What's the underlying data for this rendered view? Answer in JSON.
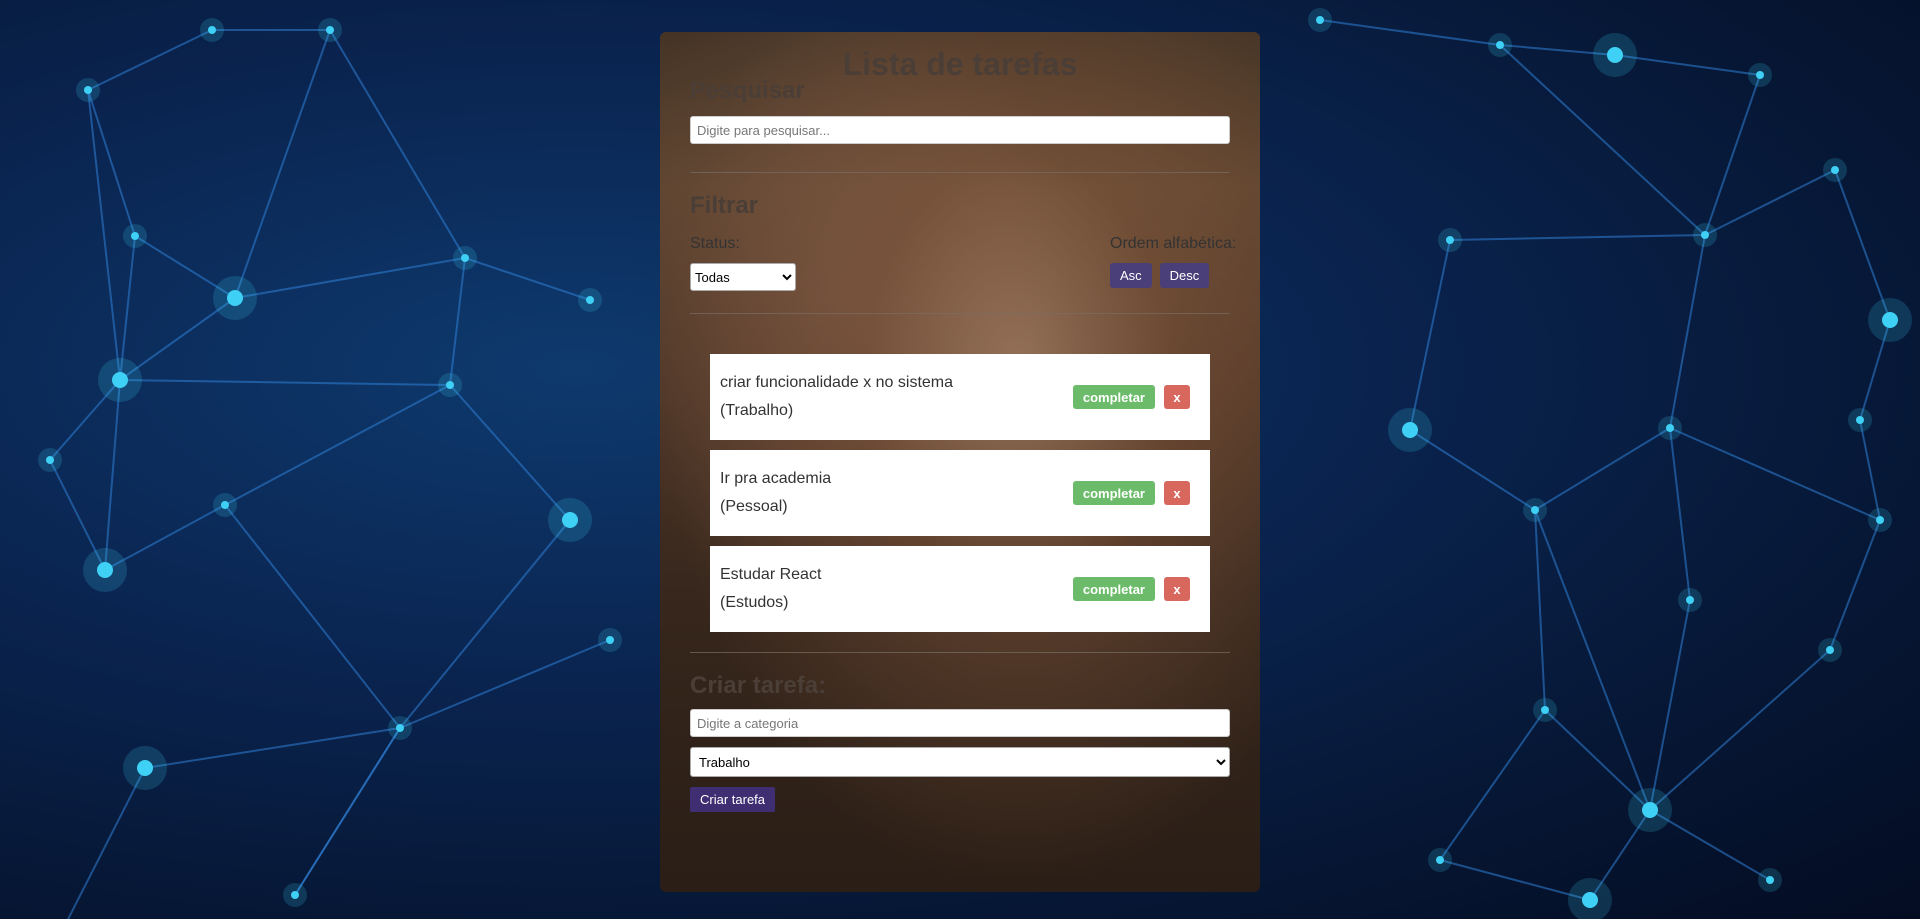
{
  "app": {
    "title": "Lista de tarefas"
  },
  "search": {
    "title": "Pesquisar",
    "placeholder": "Digite para pesquisar..."
  },
  "filter": {
    "title": "Filtrar",
    "status_label": "Status:",
    "status_selected": "Todas",
    "order_label": "Ordem alfabética:",
    "asc_label": "Asc",
    "desc_label": "Desc"
  },
  "todos": [
    {
      "text": "criar funcionalidade x no sistema",
      "category": "(Trabalho)",
      "complete_label": "completar",
      "remove_label": "x"
    },
    {
      "text": "Ir pra academia",
      "category": "(Pessoal)",
      "complete_label": "completar",
      "remove_label": "x"
    },
    {
      "text": "Estudar React",
      "category": "(Estudos)",
      "complete_label": "completar",
      "remove_label": "x"
    }
  ],
  "create": {
    "title": "Criar tarefa:",
    "placeholder": "Digite a categoria",
    "category_selected": "Trabalho",
    "button_label": "Criar tarefa"
  },
  "colors": {
    "background": "#0a2450",
    "network_nodes": "#3fd0f5",
    "complete_button": "#6cbb6a",
    "remove_button": "#d8675e",
    "order_button": "#4b3f7a",
    "create_button": "#3f2f72"
  }
}
